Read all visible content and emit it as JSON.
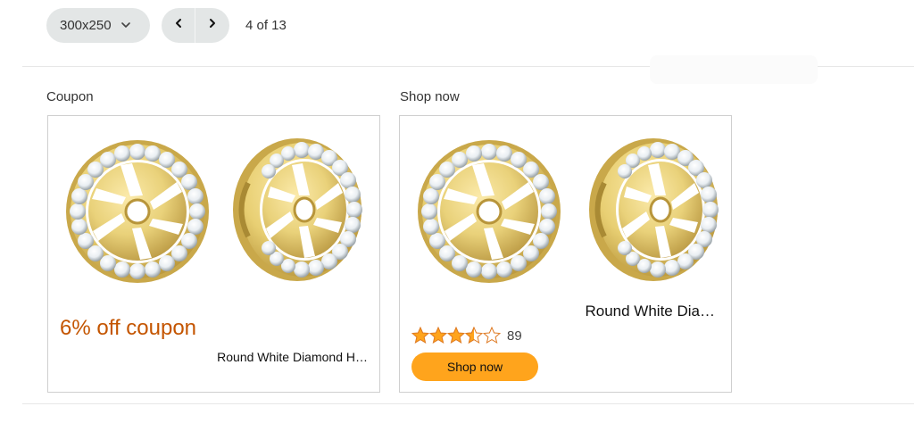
{
  "toolbar": {
    "size_selected": "300x250",
    "size_icon": "chevron-down-icon",
    "prev_icon": "chevron-left-icon",
    "next_icon": "chevron-right-icon",
    "page_indicator": "4 of 13"
  },
  "ads": [
    {
      "label": "Coupon",
      "coupon_text": "6% off coupon",
      "product_title": "Round White Diamond H…",
      "image_icon": "diamond-halo-earring-jackets-image"
    },
    {
      "label": "Shop now",
      "product_title": "Round White Dia…",
      "rating": 3.5,
      "rating_count": "89",
      "button_label": "Shop now",
      "image_icon": "diamond-halo-earring-jackets-image"
    }
  ],
  "colors": {
    "coupon": "#c45500",
    "button": "#ffa41c",
    "star": "#ffa41c",
    "pill": "#e3e6e6",
    "gold": "#e8cf73"
  }
}
